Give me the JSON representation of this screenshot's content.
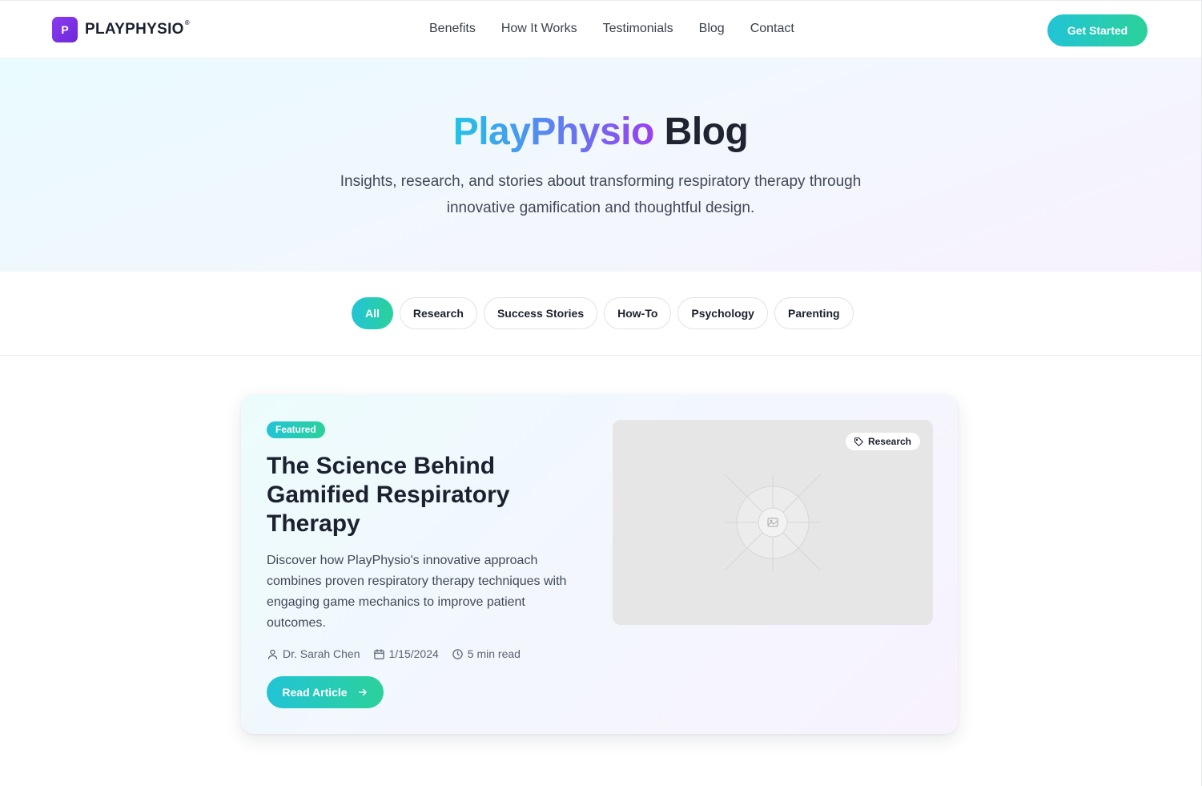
{
  "header": {
    "logo_letter": "P",
    "brand": "PLAYPHYSIO",
    "brand_mark": "®",
    "nav": [
      {
        "label": "Benefits"
      },
      {
        "label": "How It Works"
      },
      {
        "label": "Testimonials"
      },
      {
        "label": "Blog"
      },
      {
        "label": "Contact"
      }
    ],
    "cta_label": "Get Started"
  },
  "hero": {
    "title_highlight": "PlayPhysio",
    "title_rest": "Blog",
    "subtitle": "Insights, research, and stories about transforming respiratory therapy through innovative gamification and thoughtful design."
  },
  "filters": {
    "chips": [
      {
        "label": "All",
        "active": true
      },
      {
        "label": "Research",
        "active": false
      },
      {
        "label": "Success Stories",
        "active": false
      },
      {
        "label": "How-To",
        "active": false
      },
      {
        "label": "Psychology",
        "active": false
      },
      {
        "label": "Parenting",
        "active": false
      }
    ]
  },
  "featured": {
    "badge": "Featured",
    "title": "The Science Behind Gamified Respiratory Therapy",
    "excerpt": "Discover how PlayPhysio's innovative approach combines proven respiratory therapy techniques with engaging game mechanics to improve patient outcomes.",
    "author": "Dr. Sarah Chen",
    "date": "1/15/2024",
    "read_time": "5 min read",
    "read_label": "Read Article",
    "category_tag": "Research",
    "icons": {
      "author": "user-icon",
      "date": "calendar-icon",
      "read_time": "clock-icon",
      "read_arrow": "arrow-right-icon",
      "tag": "tag-icon",
      "image": "image-placeholder-icon"
    }
  },
  "colors": {
    "accent_start": "#22c4d6",
    "accent_end": "#2bd19a",
    "brand_purple": "#7c3aed",
    "text_dark": "#1c2130"
  }
}
